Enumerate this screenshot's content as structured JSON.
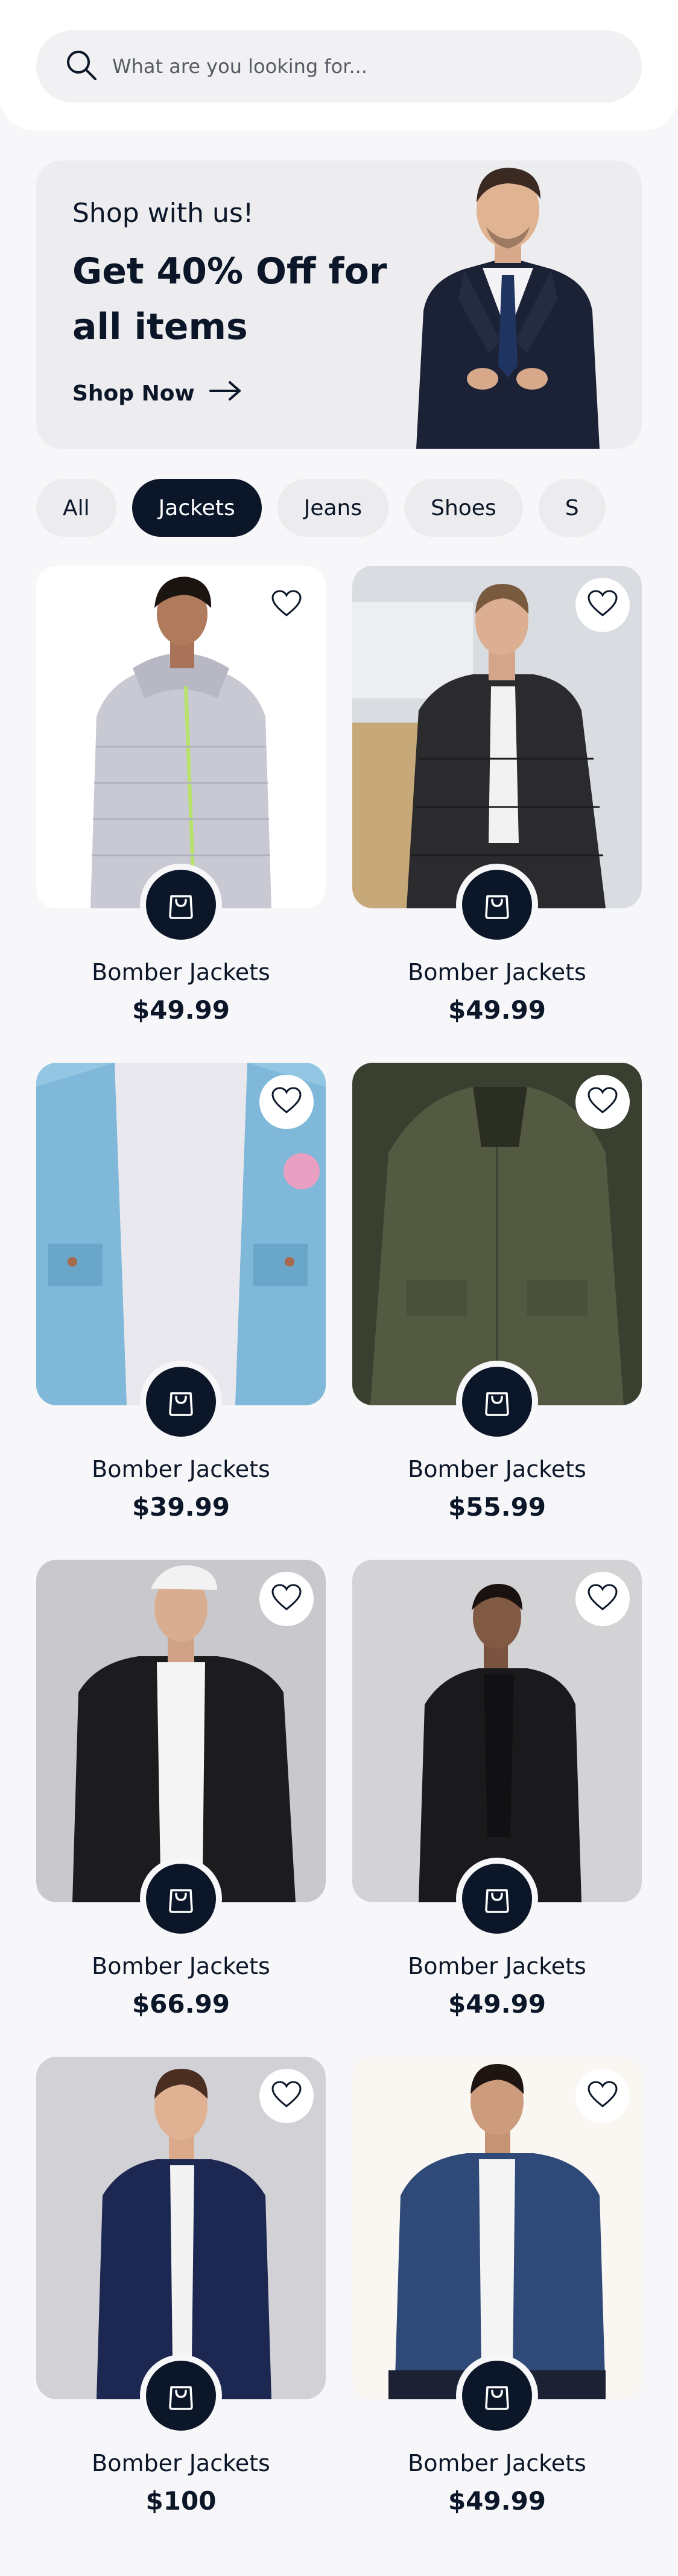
{
  "search": {
    "placeholder": "What are you looking for..."
  },
  "banner": {
    "eyebrow": "Shop with us!",
    "title": "Get 40% Off for all items",
    "cta_label": "Shop Now"
  },
  "categories": [
    {
      "label": "All",
      "active": false
    },
    {
      "label": "Jackets",
      "active": true
    },
    {
      "label": "Jeans",
      "active": false
    },
    {
      "label": "Shoes",
      "active": false
    },
    {
      "label": "S",
      "active": false
    }
  ],
  "products": [
    {
      "name": "Bomber Jackets",
      "price": "$49.99"
    },
    {
      "name": "Bomber Jackets",
      "price": "$49.99"
    },
    {
      "name": "Bomber Jackets",
      "price": "$39.99"
    },
    {
      "name": "Bomber Jackets",
      "price": "$55.99"
    },
    {
      "name": "Bomber Jackets",
      "price": "$66.99"
    },
    {
      "name": "Bomber Jackets",
      "price": "$49.99"
    },
    {
      "name": "Bomber Jackets",
      "price": "$100"
    },
    {
      "name": "Bomber Jackets",
      "price": "$49.99"
    }
  ],
  "icons": {
    "search": "search-icon",
    "arrow": "arrow-right-icon",
    "favorite": "heart-icon",
    "bag": "shopping-bag-icon"
  },
  "colors": {
    "primary": "#0b1628",
    "background": "#f7f7f9",
    "chip_inactive": "#ececee",
    "banner_bg": "#ededf0"
  }
}
